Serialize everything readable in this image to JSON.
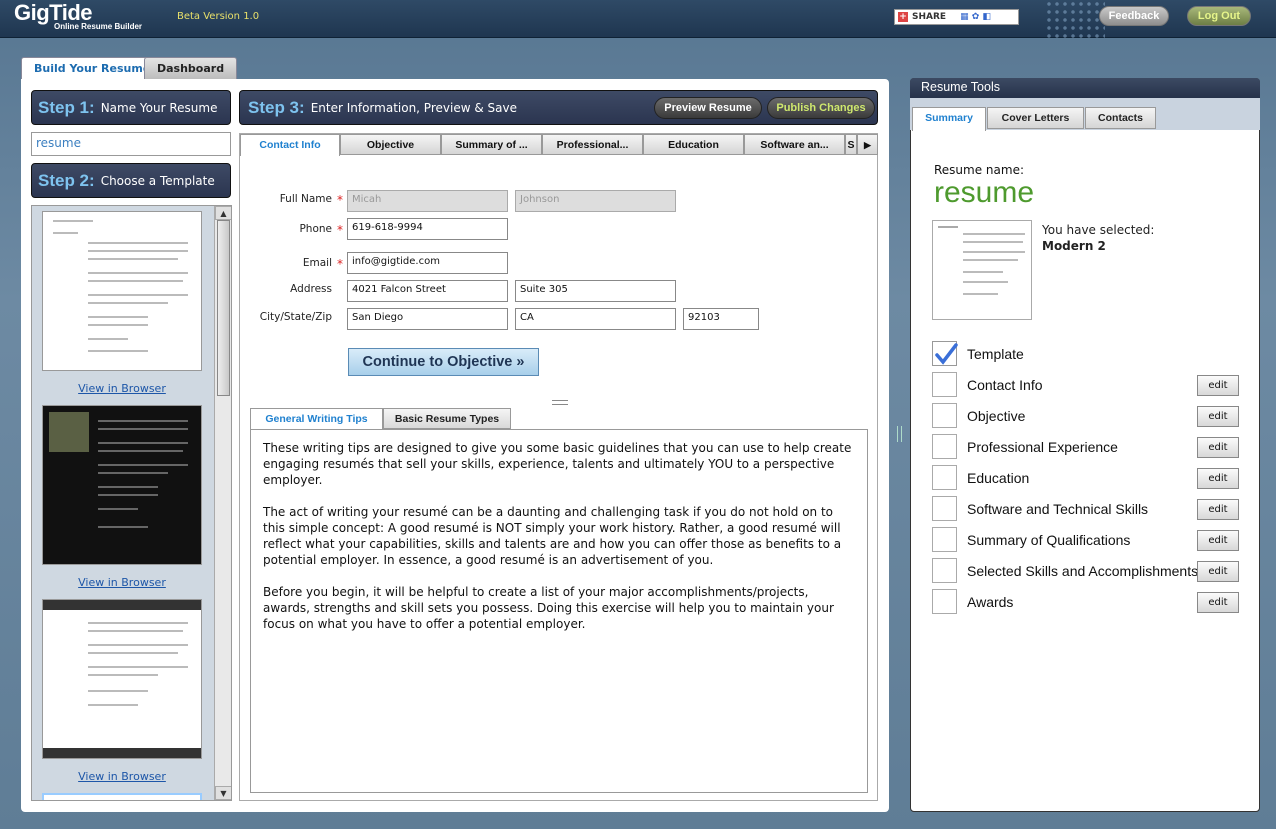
{
  "header": {
    "logo": "GigTide",
    "logo_sub": "Online Resume Builder",
    "beta": "Beta Version 1.0",
    "share_label": "SHARE",
    "feedback": "Feedback",
    "logout": "Log Out"
  },
  "main_tabs": [
    "Build Your Resume",
    "Dashboard"
  ],
  "step1": {
    "num": "Step 1:",
    "text": "Name Your Resume",
    "input_value": "resume"
  },
  "step2": {
    "num": "Step 2:",
    "text": "Choose a Template"
  },
  "templates": {
    "view_link": "View in Browser"
  },
  "step3": {
    "num": "Step 3:",
    "text": "Enter Information, Preview & Save",
    "preview": "Preview Resume",
    "publish": "Publish Changes"
  },
  "content_tabs": [
    "Contact Info",
    "Objective",
    "Summary of ...",
    "Professional...",
    "Education",
    "Software an...",
    "S"
  ],
  "form": {
    "full_name_label": "Full Name",
    "first_name": "Micah",
    "last_name": "Johnson",
    "phone_label": "Phone",
    "phone": "619-618-9994",
    "email_label": "Email",
    "email": "info@gigtide.com",
    "address_label": "Address",
    "address1": "4021 Falcon Street",
    "address2": "Suite 305",
    "csz_label": "City/State/Zip",
    "city": "San Diego",
    "state": "CA",
    "zip": "92103",
    "continue": "Continue to Objective »"
  },
  "tips_tabs": [
    "General Writing Tips",
    "Basic Resume Types"
  ],
  "tips": {
    "p1": "These writing tips are designed to give you some basic guidelines that you can use to help create engaging resumés that sell your skills, experience, talents and ultimately YOU to a perspective employer.",
    "p2": "The act of writing your resumé can be a daunting and challenging task if you do not hold on to this simple concept: A good resumé is NOT simply your work history. Rather, a good resumé will reflect what your capabilities, skills and talents are and how you can offer those as benefits to a potential employer. In essence, a good resumé is an advertisement of you.",
    "p3": "Before you begin, it will be helpful to create a list of your major accomplishments/projects, awards, strengths and skill sets you possess. Doing this exercise will help you to maintain your focus on what you have to offer a potential employer."
  },
  "tools": {
    "title": "Resume Tools",
    "tabs": [
      "Summary",
      "Cover Letters",
      "Contacts"
    ],
    "resume_name_label": "Resume name:",
    "resume_name": "resume",
    "selected_label": "You have selected:",
    "selected_template": "Modern 2",
    "edit_label": "edit",
    "checklist": [
      {
        "label": "Template",
        "checked": true
      },
      {
        "label": "Contact Info",
        "checked": false
      },
      {
        "label": "Objective",
        "checked": false
      },
      {
        "label": "Professional Experience",
        "checked": false
      },
      {
        "label": "Education",
        "checked": false
      },
      {
        "label": "Software and Technical Skills",
        "checked": false
      },
      {
        "label": "Summary of Qualifications",
        "checked": false
      },
      {
        "label": "Selected Skills and Accomplishments",
        "checked": false
      },
      {
        "label": "Awards",
        "checked": false
      }
    ]
  },
  "colors": {
    "accent": "#2081cf",
    "resume_name": "#4e9a2e",
    "header_bg": "#26324a"
  }
}
